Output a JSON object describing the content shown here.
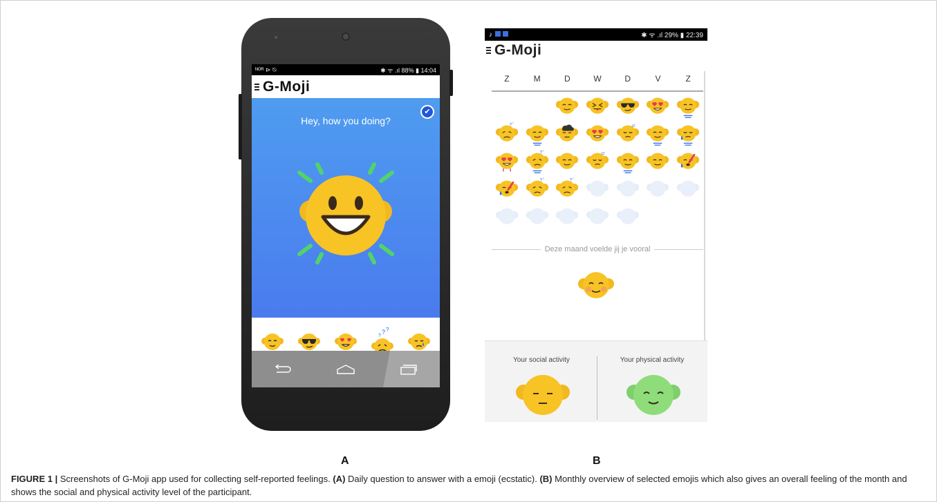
{
  "phone_a": {
    "status_left": "ᴺᴼᴿ ⊳ ⍉",
    "status_right": "✱ ᯤ .ıl 88% ▮ 14:04",
    "app_title": "G-Moji",
    "question": "Hey, how you doing?",
    "check_icon": "check-icon",
    "picker": [
      "relieved",
      "cool-sunglasses",
      "heart-eyes",
      "confused",
      "sad-tear"
    ],
    "panel_label": "A"
  },
  "screen_b": {
    "status_right": "✱ ᯤ .ıl 29% ▮ 22:39",
    "app_title": "G-Moji",
    "days": [
      "Z",
      "M",
      "D",
      "W",
      "D",
      "V",
      "Z"
    ],
    "calendar": [
      [
        "",
        "",
        "relieved",
        "tongue",
        "cool",
        "heart-eyes",
        "relieved-bar"
      ],
      [
        "confused",
        "relieved-bar",
        "cloud",
        "heart-eyes",
        "sleepy",
        "relieved-bar",
        "sweat"
      ],
      [
        "heart-eyes-steam",
        "confused-bar",
        "relieved",
        "sleepy",
        "relieved-bar",
        "relieved",
        "sick"
      ],
      [
        "sick",
        "confused",
        "confused",
        "empty",
        "empty",
        "empty",
        "empty"
      ],
      [
        "empty",
        "empty",
        "empty",
        "empty",
        "empty",
        "",
        ""
      ]
    ],
    "month_caption": "Deze maand voelde jij je vooral",
    "social_label": "Your social activity",
    "physical_label": "Your physical activity",
    "panel_label": "B"
  },
  "caption": {
    "lead": "FIGURE 1 |",
    "text1": " Screenshots of G-Moji app used for collecting self-reported feelings. ",
    "a": "(A)",
    "text2": " Daily question to answer with a emoji (ecstatic). ",
    "b": "(B)",
    "text3": " Monthly overview of selected emojis which also gives an overall feeling of the month and shows the social and physical activity level of the participant."
  },
  "colors": {
    "emoji_yellow": "#f7c325",
    "blue_top": "#4f9cf0",
    "blue_bottom": "#4a7bee",
    "physical_green": "#8fdc7a"
  }
}
